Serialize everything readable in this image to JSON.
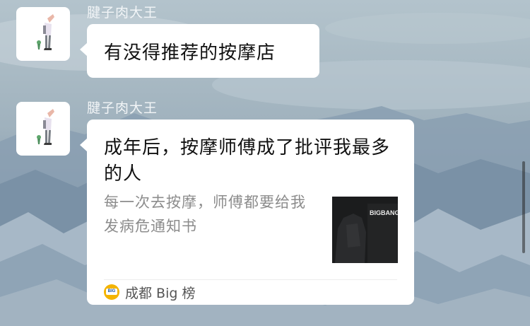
{
  "messages": [
    {
      "sender": "腱子肉大王",
      "text": "有没得推荐的按摩店"
    },
    {
      "sender": "腱子肉大王",
      "card": {
        "title": "成年后，按摩师傅成了批评我最多的人",
        "description": "每一次去按摩，师傅都要给我发病危通知书",
        "thumbnail_text": "BIGBANG",
        "source_name": "成都 Big 榜",
        "source_logo_text": "BIG"
      }
    }
  ],
  "colors": {
    "bubble": "#ffffff",
    "sender_name": "#f2f5f7",
    "description": "#8c8c8c",
    "source_logo": "#f4b400"
  },
  "icons": {
    "avatar": "cartoon-figure-avatar",
    "source": "source-logo-icon"
  }
}
